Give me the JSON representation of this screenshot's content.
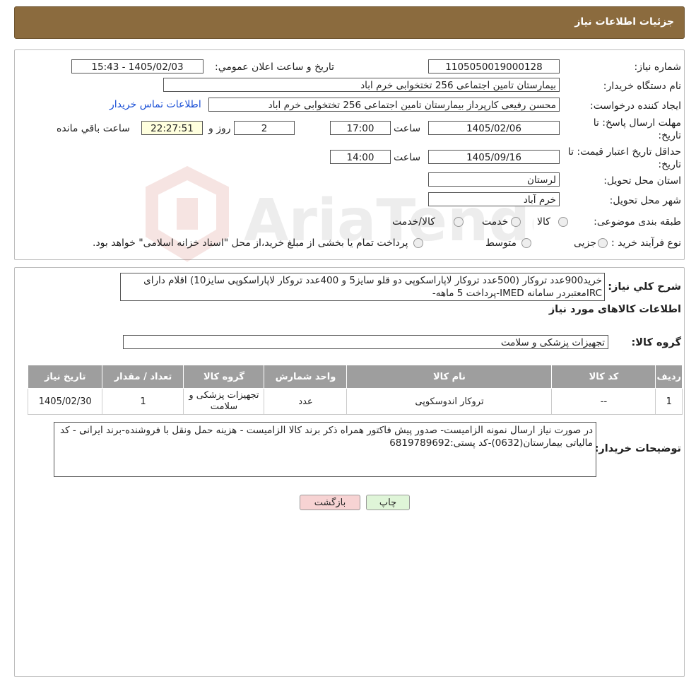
{
  "header": {
    "title": "جزئیات اطلاعات نیاز"
  },
  "form": {
    "need_number_label": "شماره نیاز:",
    "need_number": "1105050019000128",
    "announce_label": "تاریخ و ساعت اعلان عمومي:",
    "announce_value": "1405/02/03 - 15:43",
    "buyer_label": "نام دستگاه خریدار:",
    "buyer_value": "بیمارستان تامین اجتماعی  256 تختخوابی خرم اباد",
    "creator_label": "ایجاد کننده درخواست:",
    "creator_value": "محسن رفیعی کارپرداز بیمارستان تامین اجتماعی  256 تختخوابی خرم اباد",
    "contact_link": "اطلاعات تماس خریدار",
    "deadline_label_1": "مهلت ارسال پاسخ: تا",
    "deadline_label_2": "تاریخ:",
    "deadline_date": "1405/02/06",
    "time_label": "ساعت",
    "deadline_time": "17:00",
    "days_value": "2",
    "days_label": "روز و",
    "remaining_value": "22:27:51",
    "remaining_label": "ساعت باقي مانده",
    "validity_label_1": "حداقل تاریخ اعتبار قیمت: تا",
    "validity_label_2": "تاریخ:",
    "validity_date": "1405/09/16",
    "validity_time": "14:00",
    "province_label": "استان محل تحویل:",
    "province_value": "لرستان",
    "city_label": "شهر محل تحویل:",
    "city_value": "خرم آباد",
    "category_label": "طبقه بندی موضوعی:",
    "category_options": [
      "کالا",
      "خدمت",
      "کالا/خدمت"
    ],
    "process_label": "نوع فرآیند خرید :",
    "process_options": [
      "جزیی",
      "متوسط"
    ],
    "process_note": "پرداخت تمام یا بخشی از مبلغ خرید،از محل \"اسناد خزانه اسلامی\" خواهد بود."
  },
  "summary": {
    "label": "شرح کلي نیاز:",
    "text": "خرید900عدد تروکار (500عدد تروکار لاپاراسکوپی دو قلو سایز5 و 400عدد تروکار لاپاراسکوپی سایز10) اقلام دارای IRCمعتبردر سامانه IMED-پرداخت 5 ماهه-"
  },
  "goods": {
    "section_title": "اطلاعات کالاهای مورد نیاز",
    "group_label": "گروه کالا:",
    "group_value": "تجهیزات پزشکی و سلامت",
    "columns": [
      "ردیف",
      "کد کالا",
      "نام کالا",
      "واحد شمارش",
      "گروه کالا",
      "تعداد / مقدار",
      "تاریخ نیاز"
    ],
    "rows": [
      [
        "1",
        "--",
        "تروکار اندوسکوپی",
        "عدد",
        "تجهیزات پزشکی و سلامت",
        "1",
        "1405/02/30"
      ]
    ]
  },
  "buyer_notes": {
    "label": "توضیحات خریدار:",
    "text": "در صورت نیاز ارسال نمونه الزامیست- صدور پیش فاکتور همراه ذکر برند کالا  الزامیست - هزینه حمل ونقل با فروشنده-برند ایرانی - کد مالیاتی بیمارستان(0632)-کد پستی:6819789692"
  },
  "buttons": {
    "print": "چاپ",
    "back": "بازگشت"
  },
  "watermark": {
    "text": "AriaTender.neT"
  },
  "colors": {
    "header_bg": "#8b6b3e",
    "link": "#1a4fd6",
    "yellow_box": "#ffffde",
    "back_btn": "#f7d3d3",
    "print_btn": "#dff5d8",
    "table_head": "#9e9e9e"
  }
}
